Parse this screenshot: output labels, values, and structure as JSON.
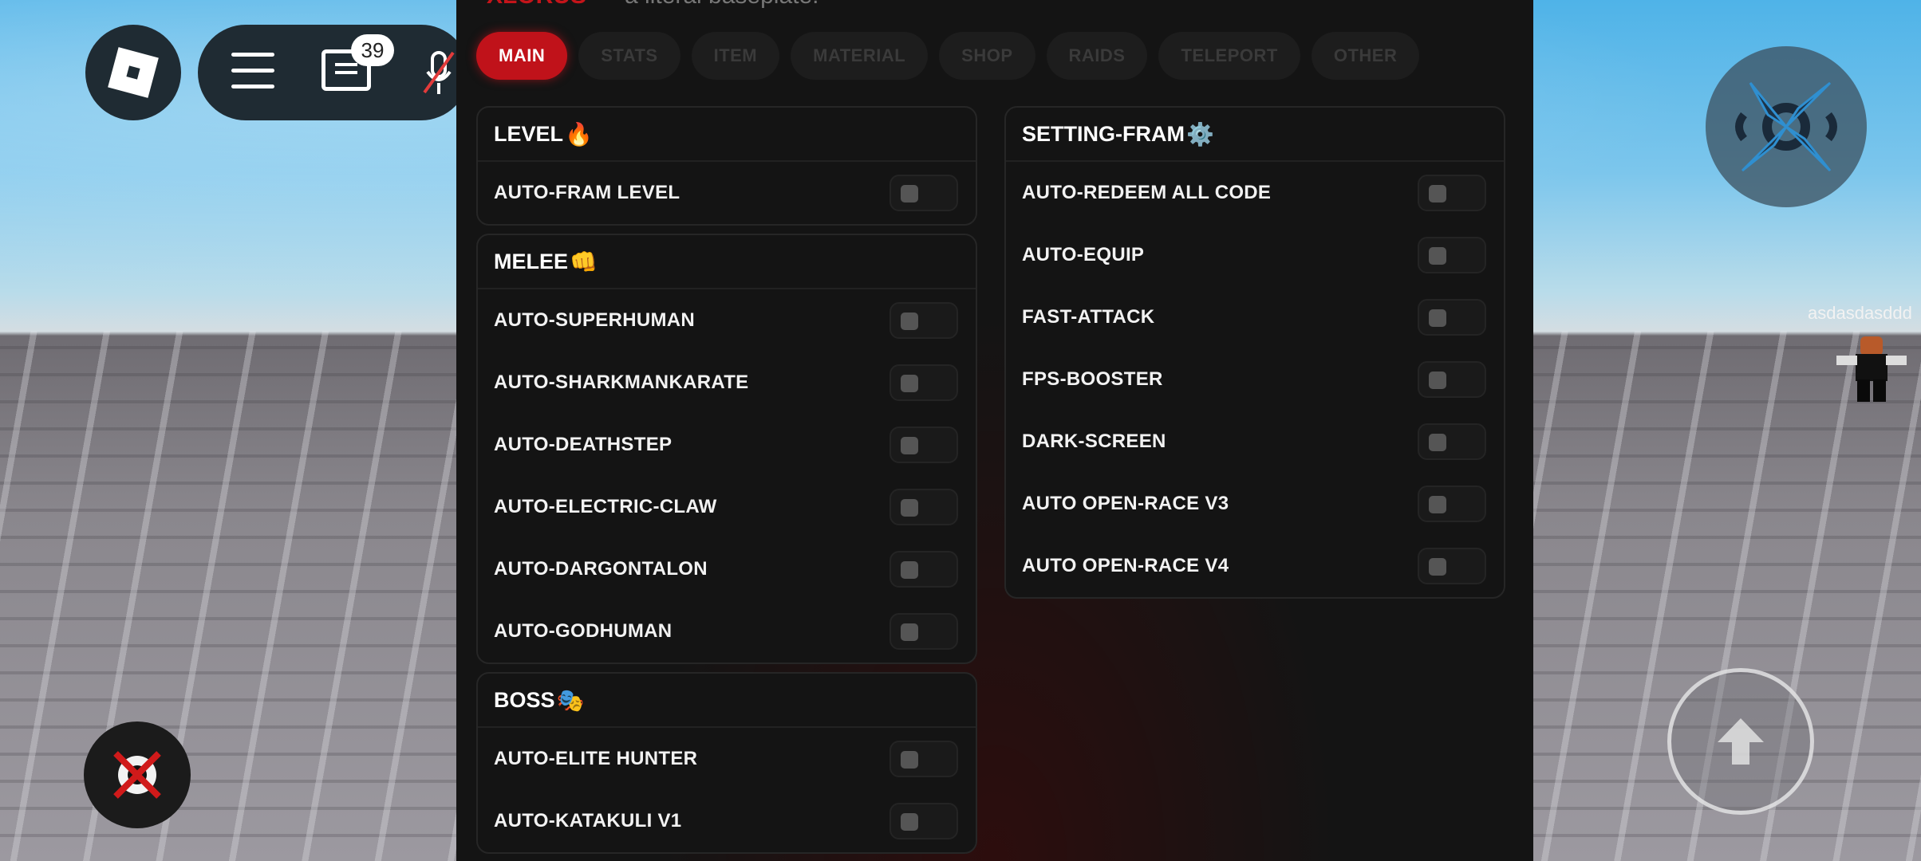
{
  "roblox": {
    "chat_badge": "39",
    "player_name": "asdasdasddd"
  },
  "panel": {
    "brand": "XLORUS",
    "subtitle": "a literal baseplate.",
    "tabs": [
      "MAIN",
      "STATS",
      "ITEM",
      "MATERIAL",
      "SHOP",
      "RAIDS",
      "TELEPORT",
      "OTHER"
    ],
    "active_tab": "MAIN"
  },
  "sections": {
    "level": {
      "title": "LEVEL",
      "emoji": "🔥",
      "items": [
        "AUTO-FRAM LEVEL"
      ]
    },
    "melee": {
      "title": "MELEE",
      "emoji": "👊",
      "items": [
        "AUTO-SUPERHUMAN",
        "AUTO-SHARKMANKARATE",
        "AUTO-DEATHSTEP",
        "AUTO-ELECTRIC-CLAW",
        "AUTO-DARGONTALON",
        "AUTO-GODHUMAN"
      ]
    },
    "boss": {
      "title": "BOSS",
      "emoji": "🎭",
      "items": [
        "AUTO-ELITE HUNTER",
        "AUTO-KATAKULI V1"
      ]
    },
    "setting": {
      "title": "SETTING-FRAM",
      "emoji": "⚙️",
      "items": [
        "AUTO-REDEEM ALL CODE",
        "AUTO-EQUIP",
        "FAST-ATTACK",
        "FPS-BOOSTER",
        "DARK-SCREEN",
        "AUTO OPEN-RACE V3",
        "AUTO OPEN-RACE V4"
      ]
    }
  },
  "colors": {
    "accent": "#c0121a",
    "panel_bg": "#141414",
    "toggle_off": "#555555"
  }
}
